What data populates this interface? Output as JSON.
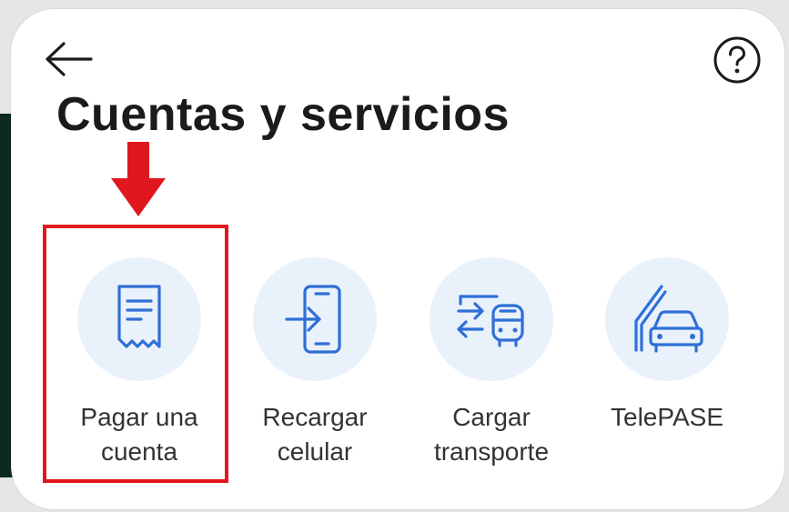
{
  "header": {
    "back_icon": "arrow-left-icon",
    "help_icon": "question-circle-icon",
    "title": "Cuentas y servicios"
  },
  "services": [
    {
      "label_line1": "Pagar una",
      "label_line2": "cuenta",
      "icon": "receipt-icon",
      "highlighted": true
    },
    {
      "label_line1": "Recargar",
      "label_line2": "celular",
      "icon": "phone-recharge-icon",
      "highlighted": false
    },
    {
      "label_line1": "Cargar",
      "label_line2": "transporte",
      "icon": "bus-card-icon",
      "highlighted": false
    },
    {
      "label_line1": "TelePASE",
      "label_line2": "",
      "icon": "car-toll-icon",
      "highlighted": false
    }
  ],
  "colors": {
    "icon_blue": "#2f6fd6",
    "circle_bg": "#e9f1fb",
    "highlight_red": "#e0181e",
    "title_text": "#1b1b1b"
  }
}
